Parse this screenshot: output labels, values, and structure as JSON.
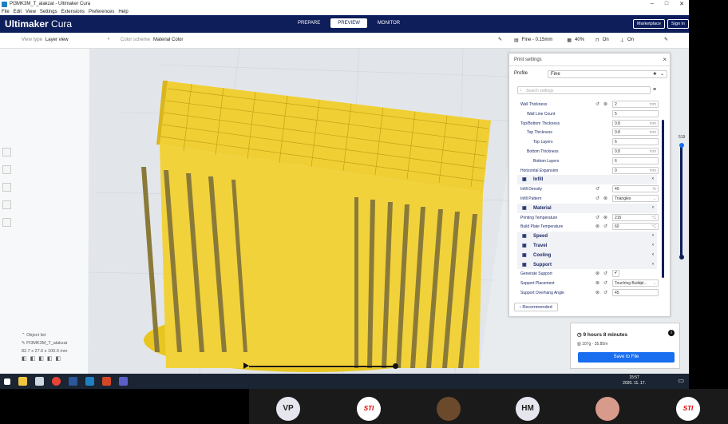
{
  "window": {
    "title": "PI3MK3M_T_alakzat - Ultimaker Cura",
    "controls": [
      "–",
      "□",
      "✕"
    ]
  },
  "menu": [
    "File",
    "Edit",
    "View",
    "Settings",
    "Extensions",
    "Preferences",
    "Help"
  ],
  "header": {
    "logo_brand": "Ultimaker",
    "logo_product": "Cura",
    "stages": [
      "PREPARE",
      "PREVIEW",
      "MONITOR"
    ],
    "active_stage": "PREVIEW",
    "marketplace": "Marketplace",
    "signin": "Sign in"
  },
  "toolbar": {
    "view_type_label": "View type",
    "view_type_value": "Layer view",
    "color_scheme_label": "Color scheme",
    "color_scheme_value": "Material Color",
    "profile_summary": "Fine - 0.15mm",
    "infill_pct": "40%",
    "support_state": "On",
    "adhesion_state": "On"
  },
  "print_settings": {
    "title": "Print settings",
    "profile_label": "Profile",
    "profile_value": "Fine",
    "search_placeholder": "Search settings",
    "rows": [
      {
        "type": "setting",
        "name": "Wall Thickness",
        "value": "2",
        "unit": "mm",
        "indent": 0,
        "icons": "reset-link"
      },
      {
        "type": "setting",
        "name": "Wall Line Count",
        "value": "5",
        "unit": "",
        "indent": 1,
        "icons": ""
      },
      {
        "type": "setting",
        "name": "Top/Bottom Thickness",
        "value": "0.8",
        "unit": "mm",
        "indent": 0,
        "icons": ""
      },
      {
        "type": "setting",
        "name": "Top Thickness",
        "value": "0.8",
        "unit": "mm",
        "indent": 1,
        "icons": ""
      },
      {
        "type": "setting",
        "name": "Top Layers",
        "value": "6",
        "unit": "",
        "indent": 2,
        "icons": ""
      },
      {
        "type": "setting",
        "name": "Bottom Thickness",
        "value": "0.8",
        "unit": "mm",
        "indent": 1,
        "icons": ""
      },
      {
        "type": "setting",
        "name": "Bottom Layers",
        "value": "6",
        "unit": "",
        "indent": 2,
        "icons": ""
      },
      {
        "type": "setting",
        "name": "Horizontal Expansion",
        "value": "0",
        "unit": "mm",
        "indent": 0,
        "icons": ""
      },
      {
        "type": "category",
        "name": "Infill"
      },
      {
        "type": "setting",
        "name": "Infill Density",
        "value": "40",
        "unit": "%",
        "indent": 0,
        "icons": "reset"
      },
      {
        "type": "setting",
        "name": "Infill Pattern",
        "value": "Triangles",
        "unit": "",
        "indent": 0,
        "icons": "reset-link",
        "dropdown": true
      },
      {
        "type": "category",
        "name": "Material"
      },
      {
        "type": "setting",
        "name": "Printing Temperature",
        "value": "215",
        "unit": "°C",
        "indent": 0,
        "icons": "reset-link"
      },
      {
        "type": "setting",
        "name": "Build Plate Temperature",
        "value": "60",
        "unit": "°C",
        "indent": 0,
        "icons": "link-reset"
      },
      {
        "type": "category",
        "name": "Speed"
      },
      {
        "type": "category",
        "name": "Travel"
      },
      {
        "type": "category",
        "name": "Cooling"
      },
      {
        "type": "category",
        "name": "Support"
      },
      {
        "type": "setting",
        "name": "Generate Support",
        "value": "✔",
        "unit": "",
        "indent": 0,
        "icons": "link-reset",
        "checkbox": true
      },
      {
        "type": "setting",
        "name": "Support Placement",
        "value": "Touching Buildpl...",
        "unit": "",
        "indent": 0,
        "icons": "link-reset",
        "dropdown": true
      },
      {
        "type": "setting",
        "name": "Support Overhang Angle",
        "value": "45",
        "unit": "",
        "indent": 0,
        "icons": "link-reset"
      }
    ],
    "recommended_button": "Recommended"
  },
  "objects": {
    "list_label": "Object list",
    "object_name": "PI3MK3M_T_alakzat",
    "dimensions": "82.7 x 27.6 x 100.0 mm"
  },
  "layer": {
    "current": "519"
  },
  "estimate": {
    "time": "9 hours 8 minutes",
    "material": "107g · 35.85m",
    "save_button": "Save to File"
  },
  "clock": {
    "time": "15:57",
    "date": "2020. 11. 17."
  },
  "participants": [
    {
      "initials": "VP",
      "kind": "initials"
    },
    {
      "initials": "STI",
      "kind": "logo"
    },
    {
      "initials": "",
      "kind": "photo"
    },
    {
      "initials": "HM",
      "kind": "initials"
    },
    {
      "initials": "",
      "kind": "photo2"
    },
    {
      "initials": "STI",
      "kind": "logo"
    }
  ],
  "colors": {
    "header_bg": "#0d1e5b",
    "accent": "#196ef0",
    "model": "#f2d23a"
  }
}
